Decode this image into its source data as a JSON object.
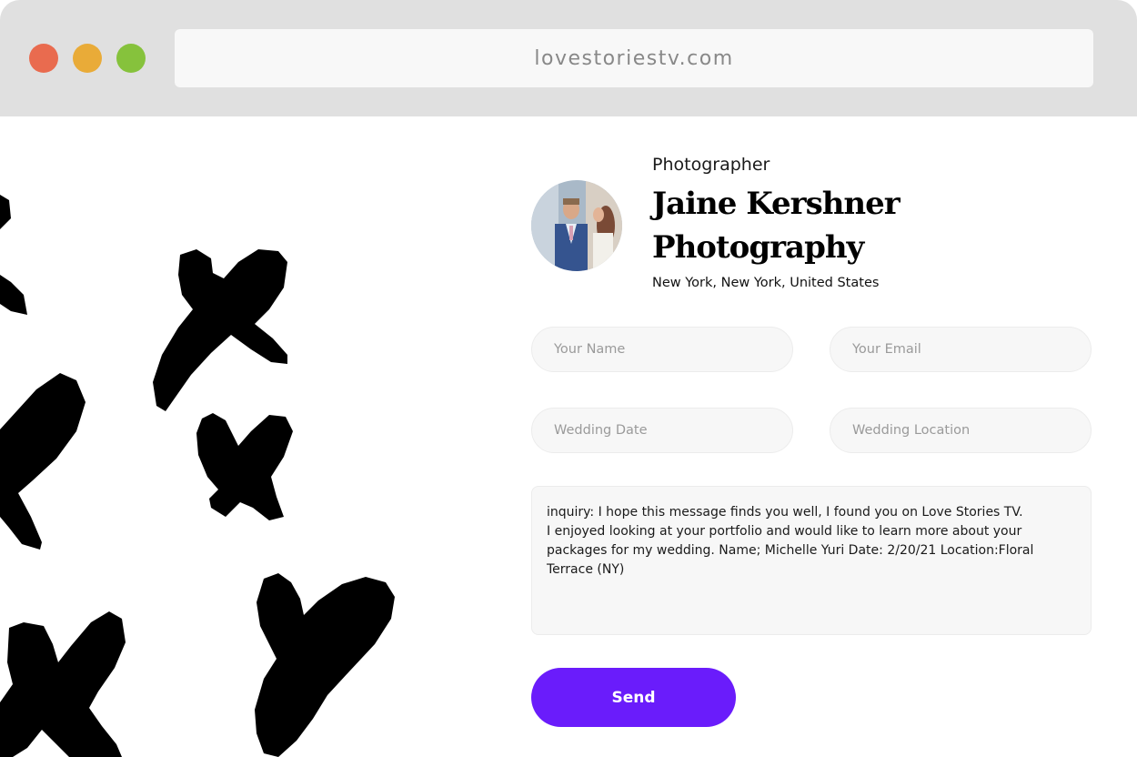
{
  "browser": {
    "url": "lovestoriestv.com",
    "colors": {
      "close": "#e96b4f",
      "minimize": "#e9ab38",
      "maximize": "#86c23c"
    }
  },
  "profile": {
    "vendor_type": "Photographer",
    "name": "Jaine Kershner Photography",
    "location": "New York, New York, United States"
  },
  "form": {
    "name_placeholder": "Your Name",
    "email_placeholder": "Your Email",
    "date_placeholder": "Wedding Date",
    "location_placeholder": "Wedding Location",
    "message_value": "inquiry: I hope this message finds you well, I found you on Love Stories TV.\nI enjoyed looking at your portfolio and would like to learn more about your packages for my wedding. Name; Michelle Yuri Date: 2/20/21 Location:Floral Terrace (NY)",
    "send_label": "Send",
    "accent_color": "#6a1cfb"
  }
}
